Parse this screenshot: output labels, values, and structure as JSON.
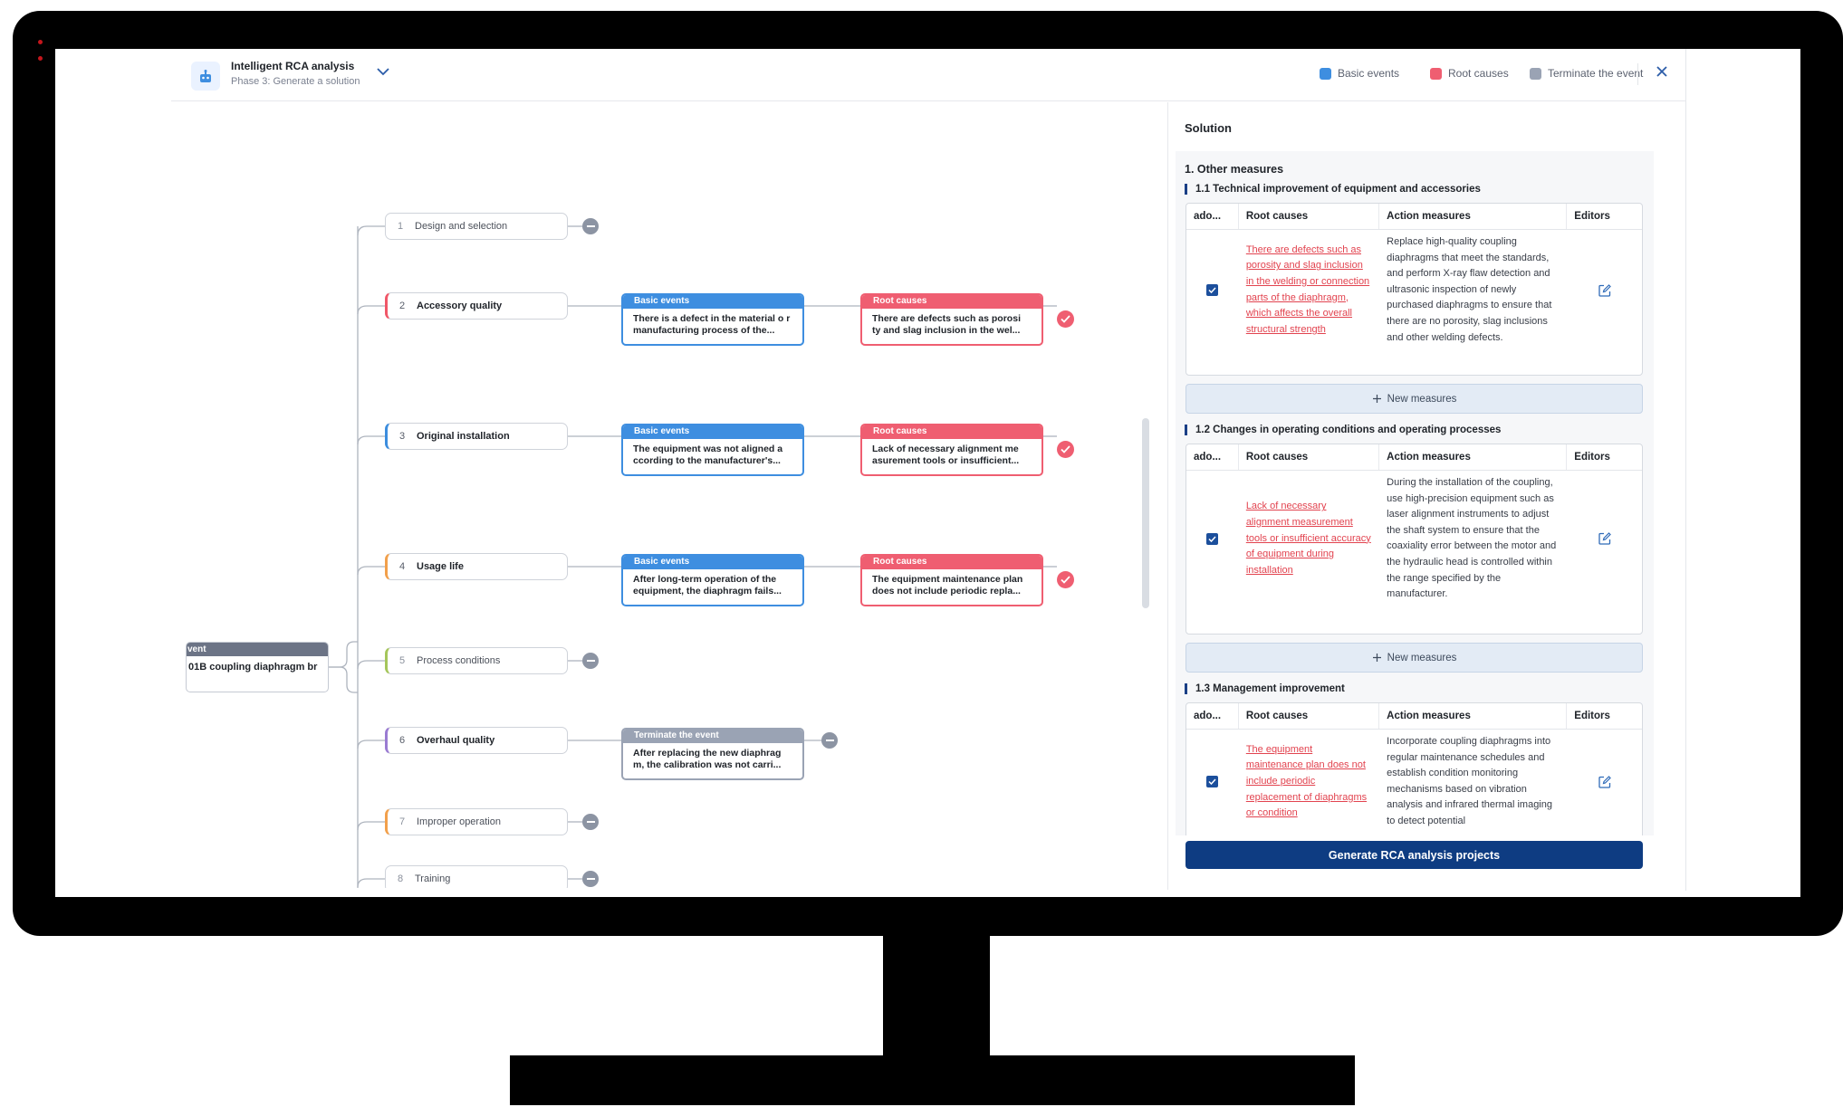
{
  "header": {
    "title": "Intelligent RCA analysis",
    "subtitle": "Phase 3: Generate a solution",
    "legend": [
      {
        "label": "Basic events",
        "color": "#3e8ee0"
      },
      {
        "label": "Root causes",
        "color": "#ef5e71"
      },
      {
        "label": "Terminate the event",
        "color": "#9aa3b4"
      }
    ]
  },
  "tree": {
    "root": {
      "header": "vent",
      "text": "01B coupling diaphragm br"
    },
    "categories": [
      {
        "num": "1",
        "label": "Design and selection"
      },
      {
        "num": "2",
        "label": "Accessory quality"
      },
      {
        "num": "3",
        "label": "Original installation"
      },
      {
        "num": "4",
        "label": "Usage life"
      },
      {
        "num": "5",
        "label": "Process conditions"
      },
      {
        "num": "6",
        "label": "Overhaul quality"
      },
      {
        "num": "7",
        "label": "Improper operation"
      },
      {
        "num": "8",
        "label": "Training"
      }
    ],
    "events": [
      {
        "type": "Basic events",
        "text": "There is a defect in the material o r manufacturing process of the..."
      },
      {
        "type": "Root causes",
        "text": "There are defects such as porosi ty and slag inclusion in the wel..."
      },
      {
        "type": "Basic events",
        "text": "The equipment was not aligned a ccording to the manufacturer's..."
      },
      {
        "type": "Root causes",
        "text": "Lack of necessary alignment me asurement tools or insufficient..."
      },
      {
        "type": "Basic events",
        "text": "After long-term operation of the equipment, the diaphragm fails..."
      },
      {
        "type": "Root causes",
        "text": "The equipment maintenance plan does not include periodic repla..."
      },
      {
        "type": "Terminate the event",
        "text": "After replacing the new diaphrag m, the calibration was not carri..."
      }
    ]
  },
  "solution": {
    "title": "Solution",
    "section1": "1. Other measures",
    "columns": {
      "adopt": "ado...",
      "root": "Root causes",
      "action": "Action measures",
      "editors": "Editors"
    },
    "subsections": [
      {
        "title": "1.1 Technical improvement of equipment and accessories",
        "root_cause": "There are defects such as porosity and slag inclusion in the welding or connection parts of the diaphragm, which affects the overall structural strength",
        "action": "Replace high-quality coupling diaphragms that meet the standards, and perform X-ray flaw detection and ultrasonic inspection of newly purchased diaphragms to ensure that there are no porosity, slag inclusions and other welding defects.",
        "checked": true
      },
      {
        "title": "1.2 Changes in operating conditions and operating processes",
        "root_cause": "Lack of necessary alignment measurement tools or insufficient accuracy of equipment during installation",
        "action": "During the installation of the coupling, use high-precision equipment such as laser alignment instruments to adjust the shaft system to ensure that the coaxiality error between the motor and the hydraulic head is controlled within the range specified by the manufacturer.",
        "checked": true
      },
      {
        "title": "1.3 Management improvement",
        "root_cause": "The equipment maintenance plan does not include periodic replacement of diaphragms or condition",
        "action": "Incorporate coupling diaphragms into regular maintenance schedules and establish condition monitoring mechanisms based on vibration analysis and infrared thermal imaging to detect potential",
        "checked": true
      }
    ],
    "new_measures": "New measures",
    "generate": "Generate RCA analysis projects"
  }
}
